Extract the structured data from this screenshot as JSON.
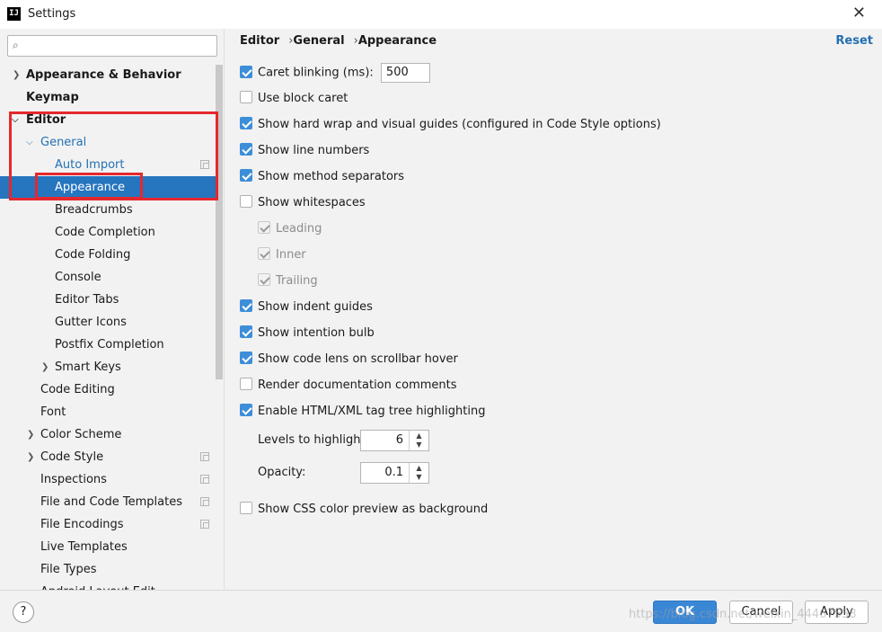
{
  "window": {
    "title": "Settings",
    "app_icon_text": "IJ",
    "close_label": "✕"
  },
  "search": {
    "placeholder": "",
    "value": ""
  },
  "tree": {
    "items": [
      {
        "label": "Appearance & Behavior"
      },
      {
        "label": "Keymap"
      },
      {
        "label": "Editor"
      },
      {
        "label": "General"
      },
      {
        "label": "Auto Import"
      },
      {
        "label": "Appearance"
      },
      {
        "label": "Breadcrumbs"
      },
      {
        "label": "Code Completion"
      },
      {
        "label": "Code Folding"
      },
      {
        "label": "Console"
      },
      {
        "label": "Editor Tabs"
      },
      {
        "label": "Gutter Icons"
      },
      {
        "label": "Postfix Completion"
      },
      {
        "label": "Smart Keys"
      },
      {
        "label": "Code Editing"
      },
      {
        "label": "Font"
      },
      {
        "label": "Color Scheme"
      },
      {
        "label": "Code Style"
      },
      {
        "label": "Inspections"
      },
      {
        "label": "File and Code Templates"
      },
      {
        "label": "File Encodings"
      },
      {
        "label": "Live Templates"
      },
      {
        "label": "File Types"
      },
      {
        "label": "Android Layout Edit"
      }
    ]
  },
  "breadcrumb": {
    "editor": "Editor",
    "general": "General",
    "appearance": "Appearance",
    "separator": "›"
  },
  "reset_label": "Reset",
  "options": {
    "caret_blinking": {
      "label": "Caret blinking (ms):",
      "value": "500",
      "checked": true
    },
    "block_caret": {
      "label": "Use block caret",
      "checked": false
    },
    "hard_wrap": {
      "label": "Show hard wrap and visual guides (configured in Code Style options)",
      "checked": true
    },
    "line_numbers": {
      "label": "Show line numbers",
      "checked": true
    },
    "method_separators": {
      "label": "Show method separators",
      "checked": true
    },
    "whitespaces": {
      "label": "Show whitespaces",
      "checked": false
    },
    "leading": {
      "label": "Leading",
      "checked": true
    },
    "inner": {
      "label": "Inner",
      "checked": true
    },
    "trailing": {
      "label": "Trailing",
      "checked": true
    },
    "indent_guides": {
      "label": "Show indent guides",
      "checked": true
    },
    "intention_bulb": {
      "label": "Show intention bulb",
      "checked": true
    },
    "code_lens": {
      "label": "Show code lens on scrollbar hover",
      "checked": true
    },
    "render_docs": {
      "label": "Render documentation comments",
      "checked": false
    },
    "tag_tree": {
      "label": "Enable HTML/XML tag tree highlighting",
      "checked": true
    },
    "levels": {
      "label": "Levels to highlight:",
      "value": "6"
    },
    "opacity": {
      "label": "Opacity:",
      "value": "0.1"
    },
    "css_preview": {
      "label": "Show CSS color preview as background",
      "checked": false
    }
  },
  "buttons": {
    "help": "?",
    "ok": "OK",
    "cancel": "Cancel",
    "apply": "Apply"
  },
  "watermark": "https://blog.csdn.net/weixin_44467558",
  "colors": {
    "accent": "#2675bf",
    "link": "#2470b3",
    "highlight_box": "#e5282e"
  }
}
